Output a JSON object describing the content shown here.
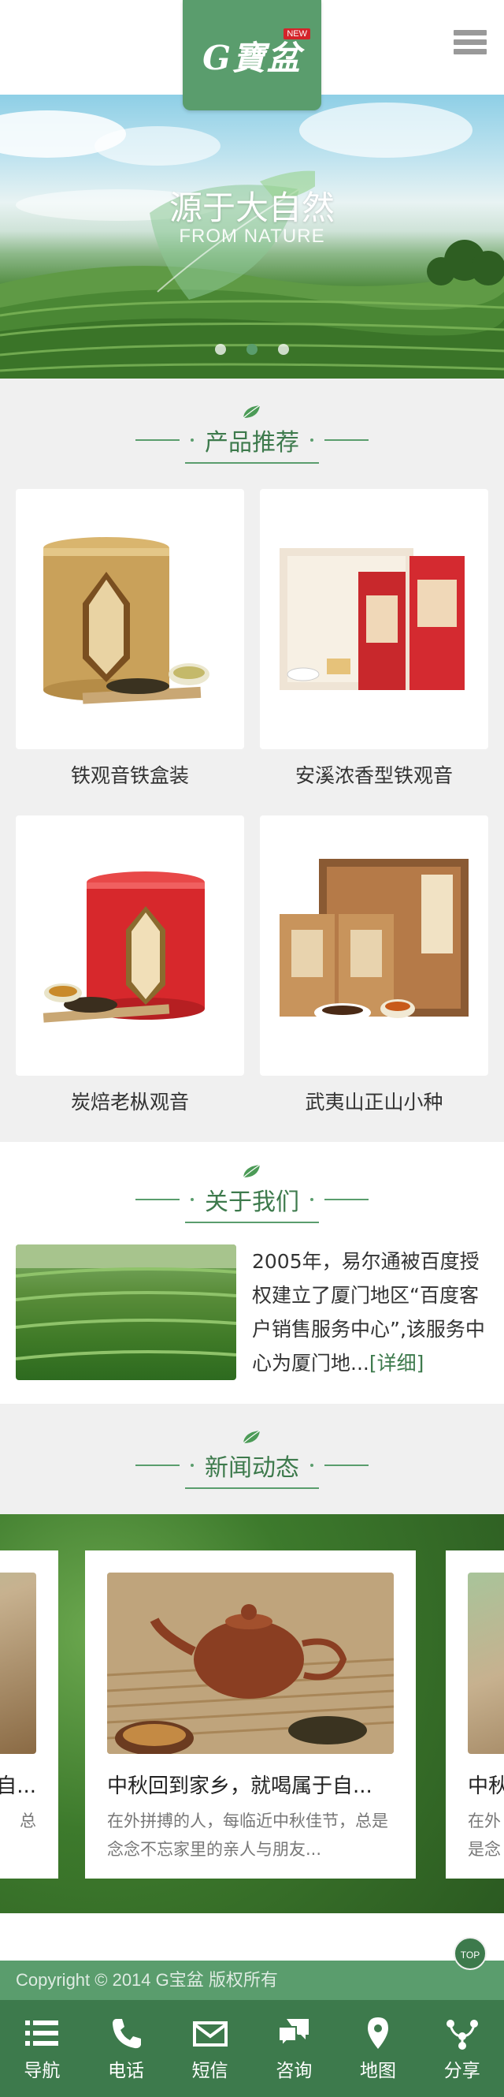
{
  "header": {
    "logo_text": "G寶盆",
    "logo_badge": "NEW"
  },
  "banner": {
    "title": "源于大自然",
    "subtitle": "FROM NATURE",
    "dots": 3,
    "active_dot": 1
  },
  "products": {
    "title": "产品推荐",
    "items": [
      {
        "name": "铁观音铁盒装"
      },
      {
        "name": "安溪浓香型铁观音"
      },
      {
        "name": "炭焙老枞观音"
      },
      {
        "name": "武夷山正山小种"
      }
    ]
  },
  "about": {
    "title": "关于我们",
    "text": "2005年，易尔通被百度授权建立了厦门地区“百度客户销售服务中心”,该服务中心为厦门地...",
    "more": "[详细]"
  },
  "news": {
    "title": "新闻动态",
    "card": {
      "title": "中秋回到家乡，就喝属于自...",
      "desc": "在外拼搏的人，每临近中秋佳节，总是念念不忘家里的亲人与朋友..."
    },
    "left_card": {
      "title": "自...",
      "desc": "总"
    },
    "right_card": {
      "title": "中秋",
      "desc": "在外是念"
    }
  },
  "footer": {
    "copyright": "Copyright © 2014 G宝盆 版权所有",
    "top_label": "TOP"
  },
  "nav": {
    "items": [
      {
        "label": "导航",
        "icon": "list-icon"
      },
      {
        "label": "电话",
        "icon": "phone-icon"
      },
      {
        "label": "短信",
        "icon": "mail-icon"
      },
      {
        "label": "咨询",
        "icon": "chat-icon"
      },
      {
        "label": "地图",
        "icon": "map-pin-icon"
      },
      {
        "label": "分享",
        "icon": "share-icon"
      }
    ]
  },
  "colors": {
    "brand_green": "#5a9d6d",
    "dark_green": "#3d7a4c",
    "badge_red": "#d4242a"
  }
}
